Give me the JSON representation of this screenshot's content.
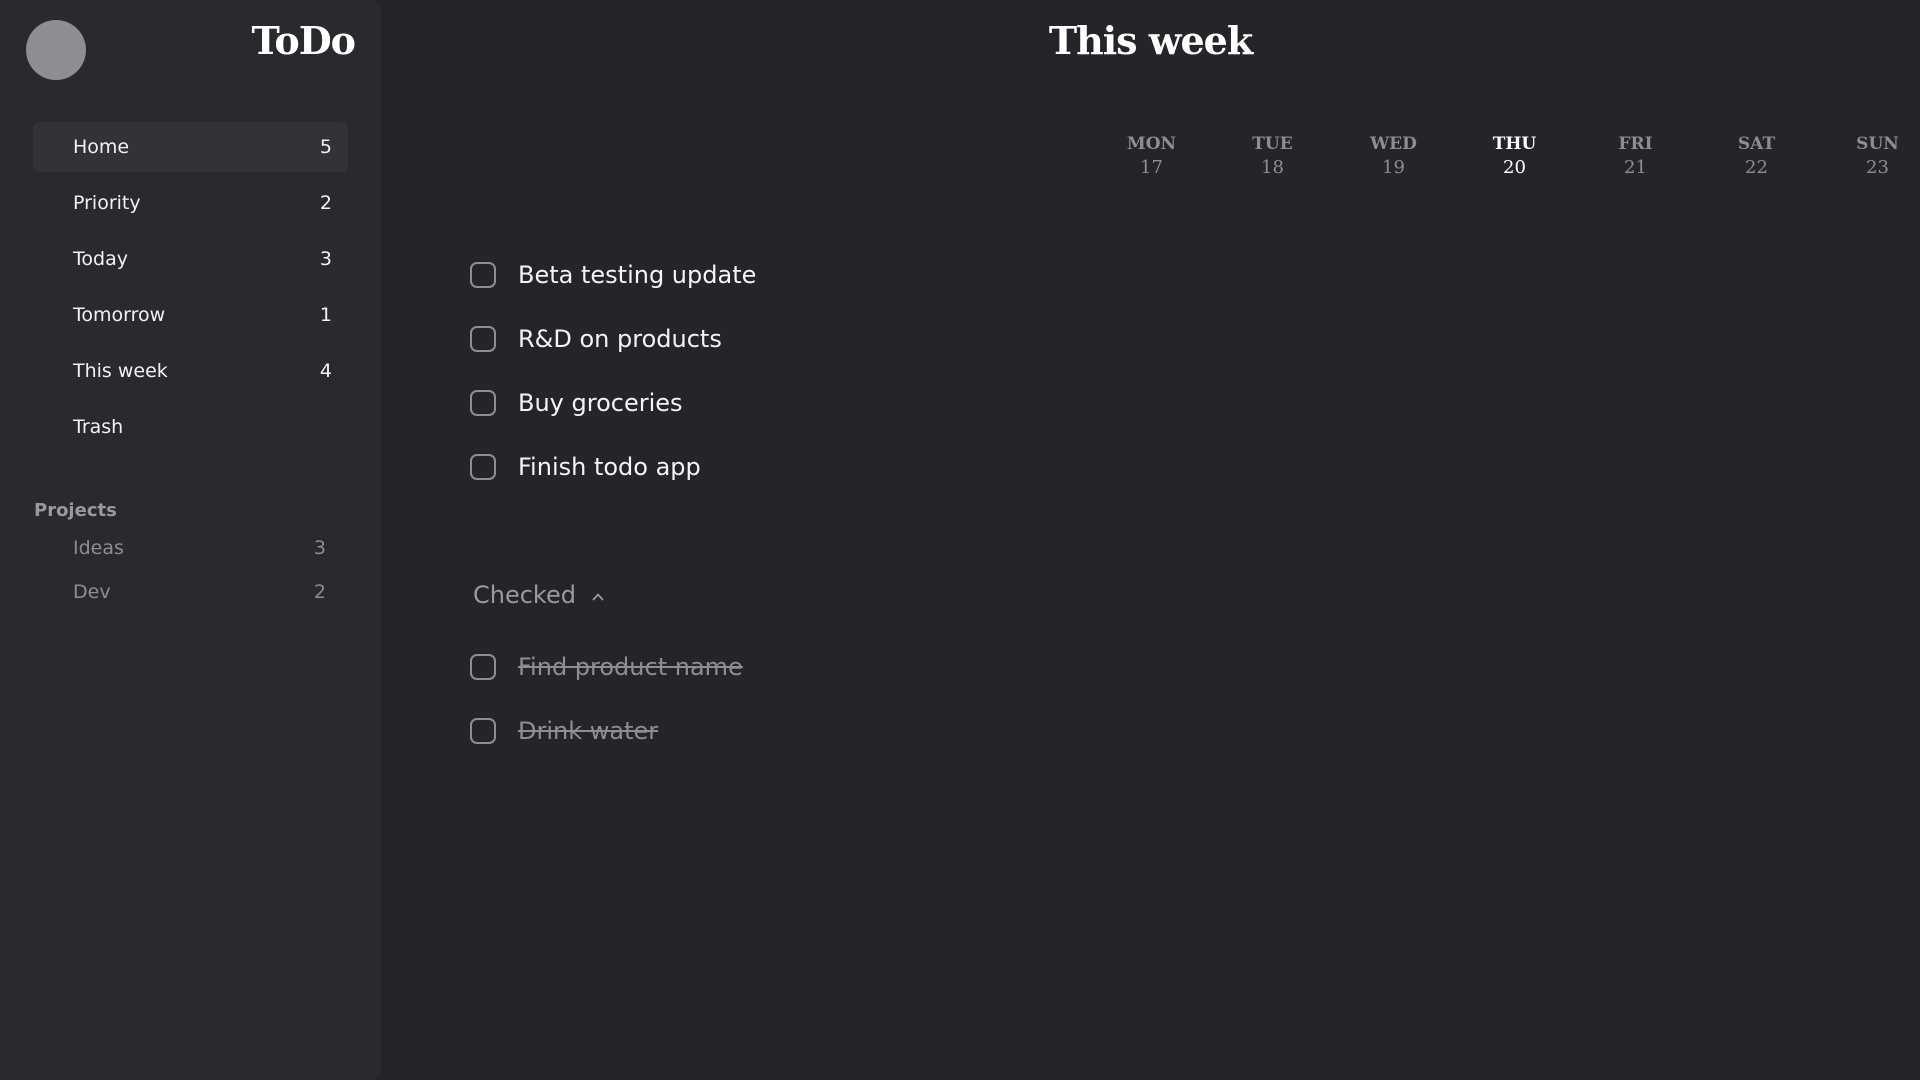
{
  "app": {
    "name": "ToDo"
  },
  "sidebar": {
    "items": [
      {
        "label": "Home",
        "count": "5",
        "active": true
      },
      {
        "label": "Priority",
        "count": "2",
        "active": false
      },
      {
        "label": "Today",
        "count": "3",
        "active": false
      },
      {
        "label": "Tomorrow",
        "count": "1",
        "active": false
      },
      {
        "label": "This week",
        "count": "4",
        "active": false
      },
      {
        "label": "Trash",
        "count": "",
        "active": false
      }
    ],
    "projects_title": "Projects",
    "projects": [
      {
        "label": "Ideas",
        "count": "3"
      },
      {
        "label": "Dev",
        "count": "2"
      }
    ]
  },
  "main": {
    "title": "This week",
    "days": [
      {
        "name": "MON",
        "num": "17",
        "active": false
      },
      {
        "name": "TUE",
        "num": "18",
        "active": false
      },
      {
        "name": "WED",
        "num": "19",
        "active": false
      },
      {
        "name": "THU",
        "num": "20",
        "active": true
      },
      {
        "name": "FRI",
        "num": "21",
        "active": false
      },
      {
        "name": "SAT",
        "num": "22",
        "active": false
      },
      {
        "name": "SUN",
        "num": "23",
        "active": false
      }
    ],
    "tasks": [
      {
        "label": "Beta testing update",
        "checked": false
      },
      {
        "label": "R&D on products",
        "checked": false
      },
      {
        "label": "Buy groceries",
        "checked": false
      },
      {
        "label": "Finish todo app",
        "checked": false
      }
    ],
    "checked_section": {
      "label": "Checked",
      "icon": "chevron-up-icon",
      "tasks": [
        {
          "label": "Find product name",
          "checked": true
        },
        {
          "label": "Drink water",
          "checked": true
        }
      ]
    }
  },
  "colors": {
    "background": "#252429",
    "sidebar": "#2a292e",
    "active_item": "#333237",
    "muted_text": "#8e8d94",
    "avatar": "#8f8d93"
  }
}
